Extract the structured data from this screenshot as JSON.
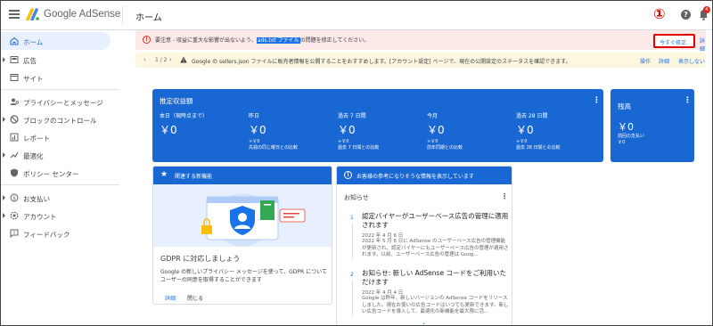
{
  "brand": "Google AdSense",
  "page_title": "ホーム",
  "annotation_marker": "①",
  "topbar": {
    "help_icon": "help-icon",
    "notifications_count": "4"
  },
  "sidebar": {
    "items": [
      {
        "label": "ホーム",
        "icon": "home-icon",
        "active": true
      },
      {
        "label": "広告",
        "icon": "ads-icon"
      },
      {
        "label": "サイト",
        "icon": "sites-icon"
      },
      {
        "label": "プライバシーとメッセージ",
        "icon": "privacy-icon"
      },
      {
        "label": "ブロックのコントロール",
        "icon": "block-icon"
      },
      {
        "label": "レポート",
        "icon": "report-icon"
      },
      {
        "label": "最適化",
        "icon": "optimize-icon"
      },
      {
        "label": "ポリシー センター",
        "icon": "policy-icon"
      },
      {
        "label": "お支払い",
        "icon": "payments-icon"
      },
      {
        "label": "アカウント",
        "icon": "account-icon"
      },
      {
        "label": "フィードバック",
        "icon": "feedback-icon"
      }
    ]
  },
  "alert": {
    "text_before": "要注意 - 収益に重大な影響が出ないよう、",
    "highlight": "ads.txt ファイル",
    "text_after": "の問題を修正してください。",
    "action": "今すぐ修正",
    "detail": "詳細"
  },
  "notice": {
    "page": "1 / 2",
    "text": "Google の sellers.json ファイルに販売者情報を公開することをおすすめします。[アカウント設定] ページで、現在の公開設定のステータスを確認できます。",
    "action_1": "操作",
    "action_2": "詳細",
    "action_3": "表示しない"
  },
  "earnings": {
    "title": "推定収益額",
    "columns": [
      {
        "label": "本日（現時点まで）",
        "value": "￥0",
        "change_1": "",
        "change_2": ""
      },
      {
        "label": "昨日",
        "value": "￥0",
        "change_1": "+￥0",
        "change_2": "先週の同じ曜日との比較"
      },
      {
        "label": "過去 7 日間",
        "value": "￥0",
        "change_1": "+￥0",
        "change_2": "過去 7 日間との比較"
      },
      {
        "label": "今月",
        "value": "￥0",
        "change_1": "+￥0",
        "change_2": "前年同期との比較"
      },
      {
        "label": "過去 28 日間",
        "value": "￥0",
        "change_1": "+￥0",
        "change_2": "過去 28 日間との比較"
      }
    ]
  },
  "balance": {
    "title": "残高",
    "value": "￥0",
    "sub_1": "前回の支払い",
    "sub_2": "￥0"
  },
  "feature_card": {
    "header": "関連する新機能",
    "title": "GDPR に対応しましょう",
    "description": "Google の新しいプライバシー メッセージを使って、GDPR について ユーザーの同意を取得することができます",
    "link_1": "詳細",
    "link_2": "閉じる"
  },
  "info_card": {
    "header": "お客様の参考になりそうな情報を表示しています",
    "subheader": "お知らせ",
    "news": [
      {
        "num": "1",
        "title": "認定バイヤーがユーザーベース広告の管理に適用されます",
        "date": "2022 年 4 月 6 日",
        "body": "2022 年 5 月 6 日に AdSense のユーザーベース広告の管理機能が更新され、認定バイヤーにもユーザーベース広告の管理が適用されます。以前、ユーザーベース広告の管理は Goog..."
      },
      {
        "num": "2",
        "title": "お知らせ: 新しい AdSense コードをご利用いただけます",
        "date": "2022 年 4 月 4 日",
        "body": "Google は昨年、新しいバージョンの AdSense コードをリリースしました。現在お使いの広告コードはいつでも更新できます。新しい広告コードを導入して、最適化の新機能を最大限に活..."
      }
    ]
  },
  "colors": {
    "primary": "#1967d2",
    "alert_bg": "#fce8e6",
    "notice_bg": "#fef7e0",
    "annotation": "#e00000"
  }
}
